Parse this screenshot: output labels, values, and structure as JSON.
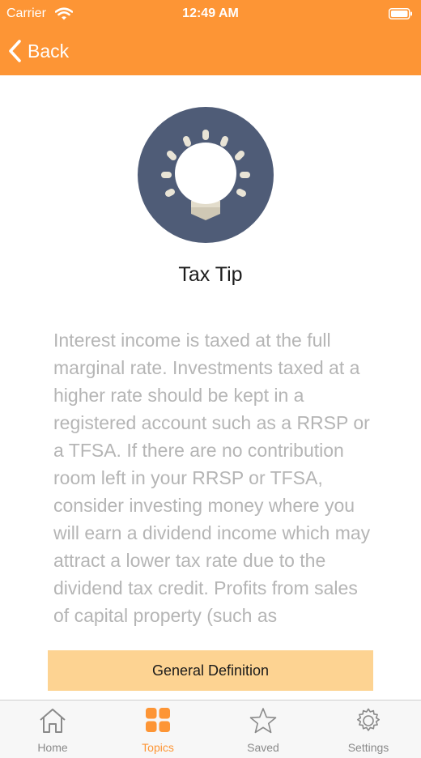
{
  "status_bar": {
    "carrier": "Carrier",
    "time": "12:49 AM"
  },
  "nav": {
    "back_label": "Back",
    "bar_color": "#fd9535"
  },
  "tip": {
    "icon": "lightbulb-icon",
    "title": "Tax Tip",
    "body": "Interest income is taxed at the full marginal rate. Investments taxed at a higher rate should be kept in a registered account such as a RRSP or a TFSA. If there are no contribution room left in your RRSP or TFSA, consider investing money where you will earn a dividend income which may attract a lower tax rate due to the dividend tax credit. Profits from sales of capital property (such as"
  },
  "definition_button": {
    "label": "General Definition",
    "color": "#fdd392"
  },
  "tab_bar": {
    "tabs": [
      {
        "label": "Home",
        "icon": "home-icon"
      },
      {
        "label": "Topics",
        "icon": "grid-icon",
        "active": true
      },
      {
        "label": "Saved",
        "icon": "star-icon"
      },
      {
        "label": "Settings",
        "icon": "gear-icon"
      }
    ],
    "active_color": "#fd9535"
  }
}
